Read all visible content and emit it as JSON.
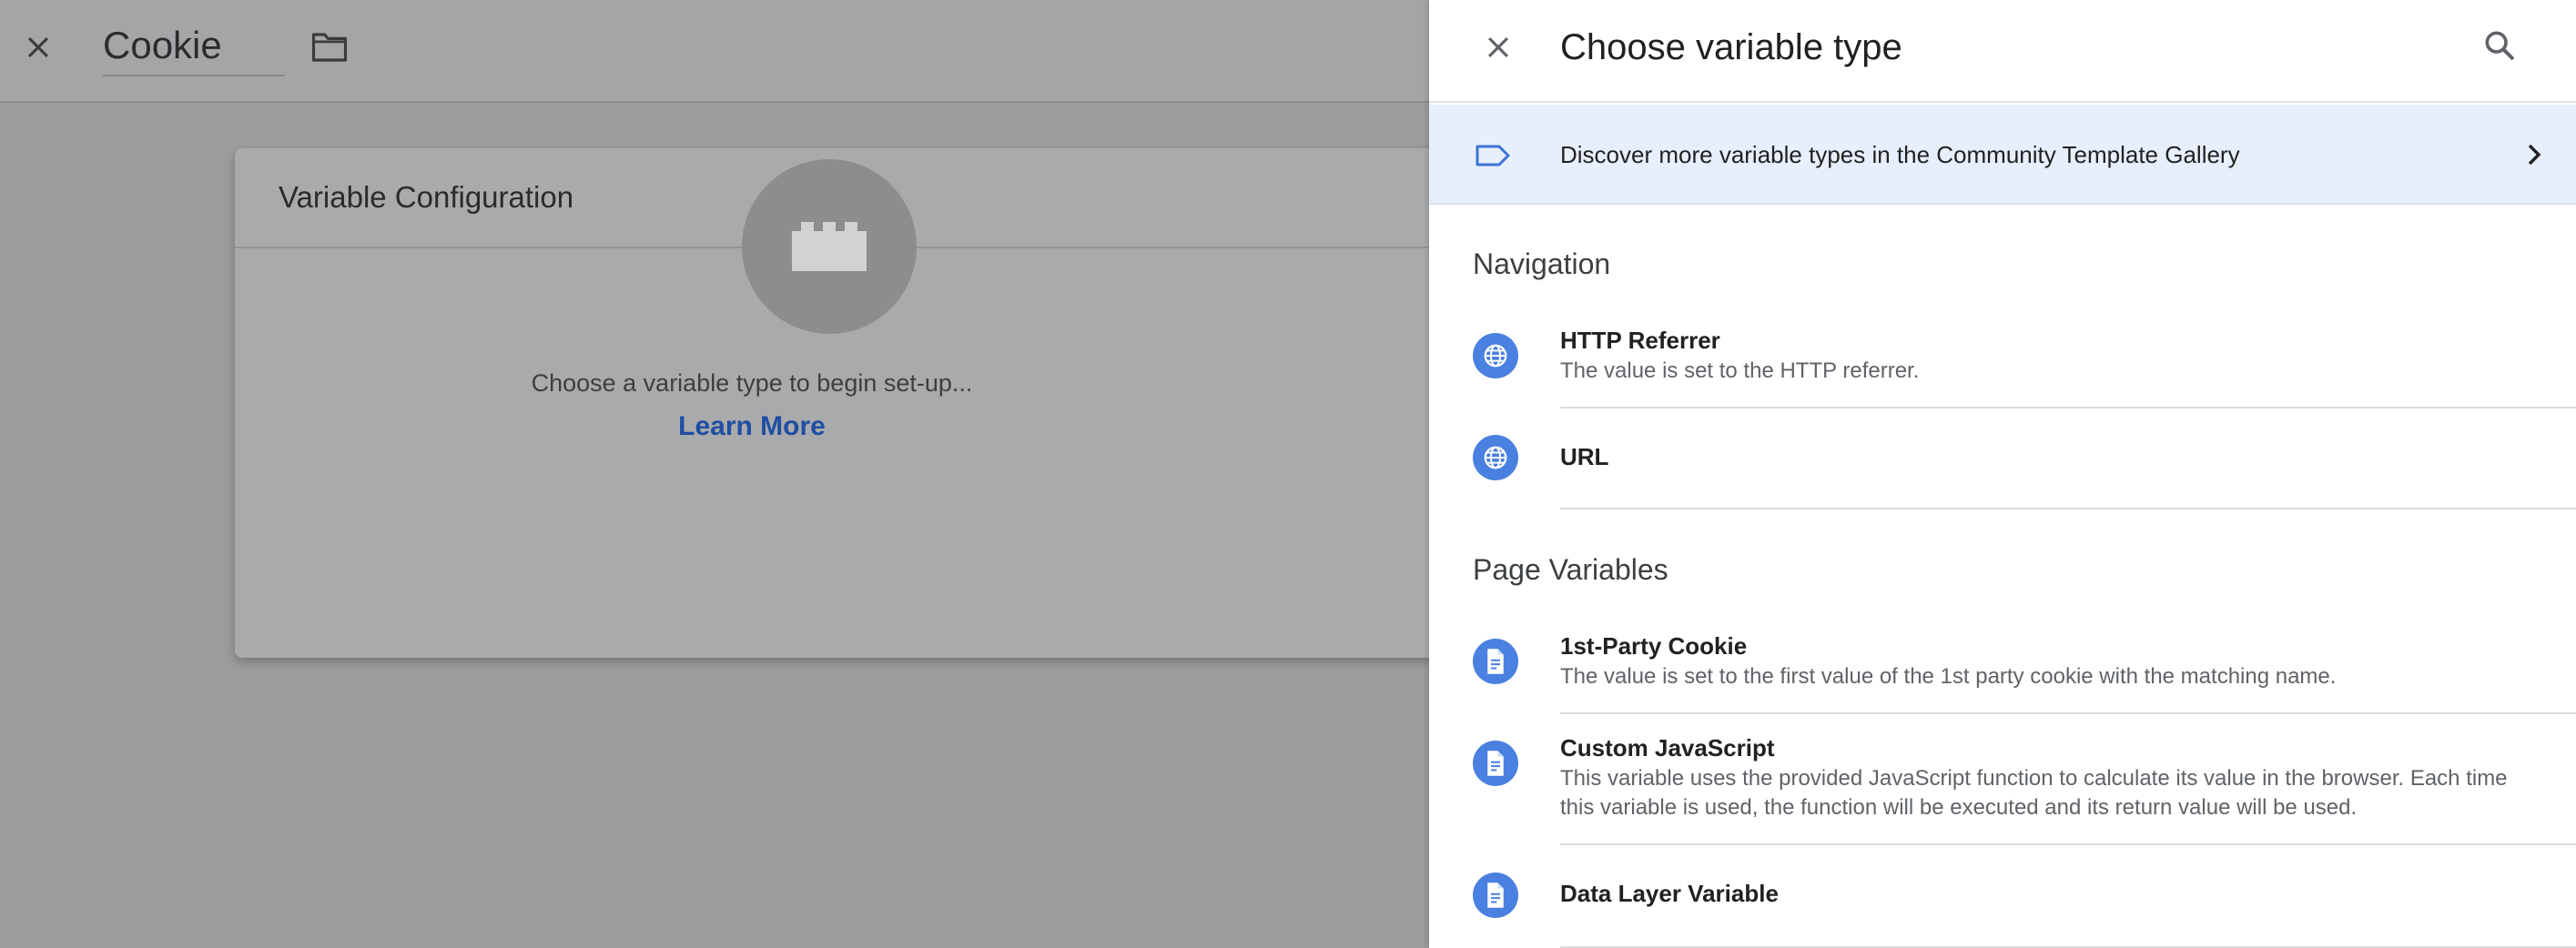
{
  "editor": {
    "name": "Cookie",
    "card_title": "Variable Configuration",
    "hint": "Choose a variable type to begin set-up...",
    "learn_more": "Learn More"
  },
  "panel": {
    "title": "Choose variable type",
    "gallery_banner": "Discover more variable types in the Community Template Gallery",
    "sections": [
      {
        "title": "Navigation",
        "items": [
          {
            "title": "HTTP Referrer",
            "description": "The value is set to the HTTP referrer.",
            "icon": "globe-icon"
          },
          {
            "title": "URL",
            "description": "",
            "icon": "globe-icon"
          }
        ]
      },
      {
        "title": "Page Variables",
        "items": [
          {
            "title": "1st-Party Cookie",
            "description": "The value is set to the first value of the 1st party cookie with the matching name.",
            "icon": "document-icon"
          },
          {
            "title": "Custom JavaScript",
            "description": "This variable uses the provided JavaScript function to calculate its value in the browser. Each time this variable is used, the function will be executed and its return value will be used.",
            "icon": "document-icon"
          },
          {
            "title": "Data Layer Variable",
            "description": "",
            "icon": "document-icon"
          }
        ]
      }
    ]
  },
  "colors": {
    "accent": "#4a80e0",
    "banner_bg": "#e8effc",
    "link": "#1f4ea3"
  }
}
